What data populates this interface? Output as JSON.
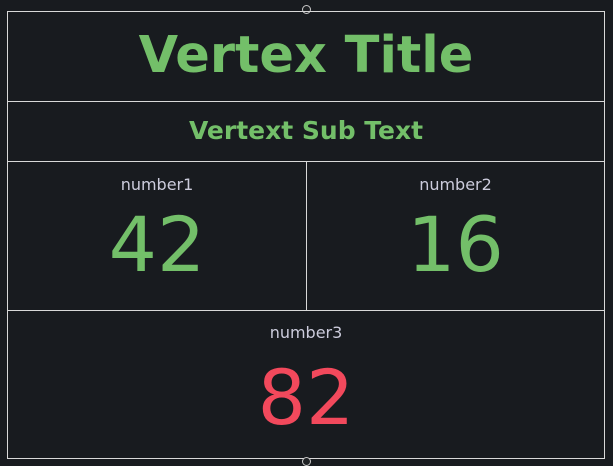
{
  "panel": {
    "title": "Vertex Title",
    "subtitle": "Vertext Sub Text"
  },
  "stats": [
    {
      "label": "number1",
      "value": "42",
      "color": "#73bf69"
    },
    {
      "label": "number2",
      "value": "16",
      "color": "#73bf69"
    },
    {
      "label": "number3",
      "value": "82",
      "color": "#f2495c"
    }
  ],
  "colors": {
    "background": "#181b1f",
    "border": "#d9d9d9",
    "green": "#73bf69",
    "red": "#f2495c",
    "label": "#ccccdc"
  }
}
